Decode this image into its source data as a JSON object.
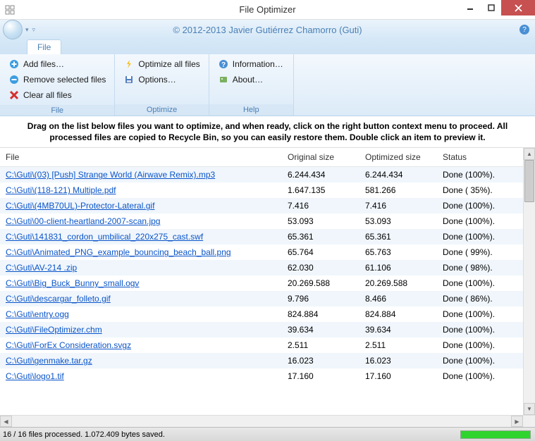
{
  "window": {
    "title": "File Optimizer"
  },
  "header": {
    "copyright": "© 2012-2013 Javier Gutiérrez Chamorro (Guti)"
  },
  "ribbon": {
    "tab": "File",
    "groups": {
      "file": {
        "label": "File",
        "add": "Add files…",
        "remove": "Remove selected files",
        "clear": "Clear all files"
      },
      "optimize": {
        "label": "Optimize",
        "optimize_all": "Optimize all files",
        "options": "Options…"
      },
      "help": {
        "label": "Help",
        "information": "Information…",
        "about": "About…"
      }
    }
  },
  "instructions": "Drag on the list below files you want to optimize, and when ready, click on the right button context menu to proceed. All processed files are copied to Recycle Bin, so you can easily restore them. Double click an item to preview it.",
  "columns": {
    "file": "File",
    "original": "Original size",
    "optimized": "Optimized size",
    "status": "Status"
  },
  "rows": [
    {
      "file": "C:\\Guti\\(03) [Push] Strange World (Airwave Remix).mp3",
      "orig": "6.244.434",
      "opt": "6.244.434",
      "status": "Done (100%)."
    },
    {
      "file": "C:\\Guti\\(118-121) Multiple.pdf",
      "orig": "1.647.135",
      "opt": "581.266",
      "status": "Done ( 35%)."
    },
    {
      "file": "C:\\Guti\\(4MB70UL)-Protector-Lateral.gif",
      "orig": "7.416",
      "opt": "7.416",
      "status": "Done (100%)."
    },
    {
      "file": "C:\\Guti\\00-client-heartland-2007-scan.jpg",
      "orig": "53.093",
      "opt": "53.093",
      "status": "Done (100%)."
    },
    {
      "file": "C:\\Guti\\141831_cordon_umbilical_220x275_cast.swf",
      "orig": "65.361",
      "opt": "65.361",
      "status": "Done (100%)."
    },
    {
      "file": "C:\\Guti\\Animated_PNG_example_bouncing_beach_ball.png",
      "orig": "65.764",
      "opt": "65.763",
      "status": "Done ( 99%)."
    },
    {
      "file": "C:\\Guti\\AV-214 .zip",
      "orig": "62.030",
      "opt": "61.106",
      "status": "Done ( 98%)."
    },
    {
      "file": "C:\\Guti\\Big_Buck_Bunny_small.ogv",
      "orig": "20.269.588",
      "opt": "20.269.588",
      "status": "Done (100%)."
    },
    {
      "file": "C:\\Guti\\descargar_folleto.gif",
      "orig": "9.796",
      "opt": "8.466",
      "status": "Done ( 86%)."
    },
    {
      "file": "C:\\Guti\\entry.ogg",
      "orig": "824.884",
      "opt": "824.884",
      "status": "Done (100%)."
    },
    {
      "file": "C:\\Guti\\FileOptimizer.chm",
      "orig": "39.634",
      "opt": "39.634",
      "status": "Done (100%)."
    },
    {
      "file": "C:\\Guti\\ForEx Consideration.svgz",
      "orig": "2.511",
      "opt": "2.511",
      "status": "Done (100%)."
    },
    {
      "file": "C:\\Guti\\genmake.tar.gz",
      "orig": "16.023",
      "opt": "16.023",
      "status": "Done (100%)."
    },
    {
      "file": "C:\\Guti\\logo1.tif",
      "orig": "17.160",
      "opt": "17.160",
      "status": "Done (100%)."
    }
  ],
  "status": "16 / 16 files processed. 1.072.409 bytes saved."
}
